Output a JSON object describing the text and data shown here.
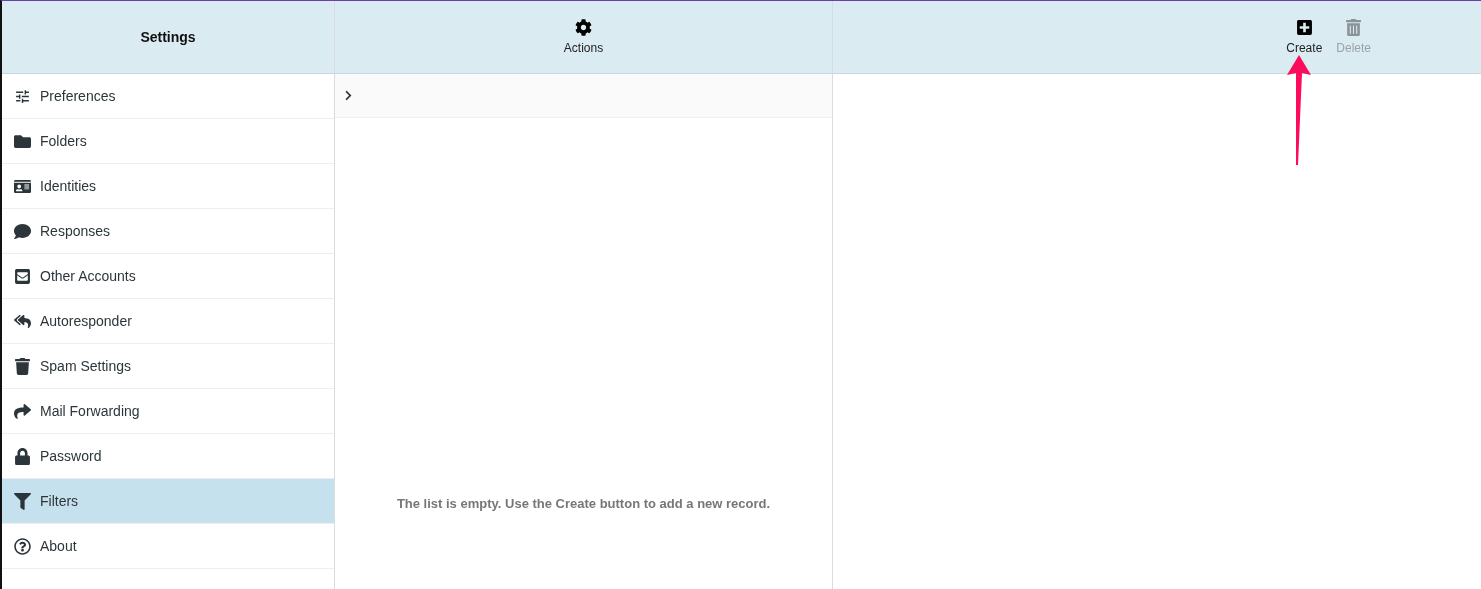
{
  "sidebar": {
    "title": "Settings",
    "items": [
      {
        "label": "Preferences",
        "selected": false
      },
      {
        "label": "Folders",
        "selected": false
      },
      {
        "label": "Identities",
        "selected": false
      },
      {
        "label": "Responses",
        "selected": false
      },
      {
        "label": "Other Accounts",
        "selected": false
      },
      {
        "label": "Autoresponder",
        "selected": false
      },
      {
        "label": "Spam Settings",
        "selected": false
      },
      {
        "label": "Mail Forwarding",
        "selected": false
      },
      {
        "label": "Password",
        "selected": false
      },
      {
        "label": "Filters",
        "selected": true
      },
      {
        "label": "About",
        "selected": false
      }
    ]
  },
  "list_toolbar": {
    "buttons": [
      {
        "label": "Actions",
        "disabled": false
      }
    ]
  },
  "list": {
    "empty_message": "The list is empty. Use the Create button to add a new record."
  },
  "content_toolbar": {
    "buttons": [
      {
        "label": "Create",
        "disabled": false
      },
      {
        "label": "Delete",
        "disabled": true
      }
    ]
  }
}
